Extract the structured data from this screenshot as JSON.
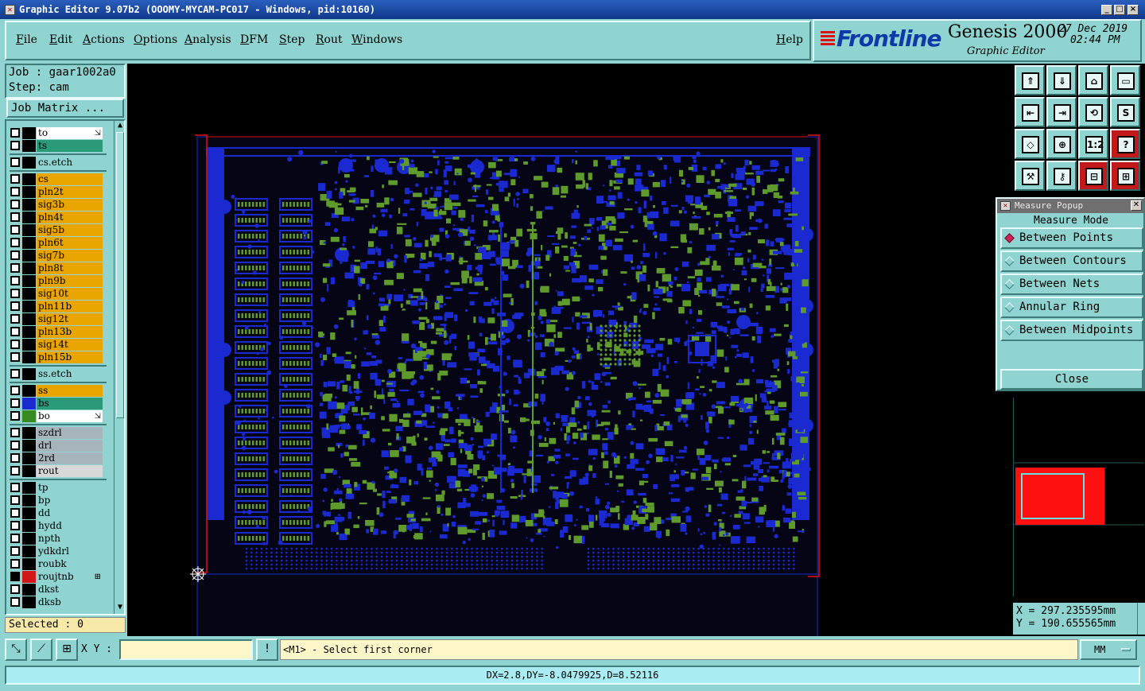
{
  "window": {
    "title": "Graphic Editor 9.07b2 (OOOMY-MYCAM-PC017 - Windows, pid:10160)",
    "icon": "app-icon",
    "minimize": "_",
    "maximize": "□",
    "close": "×"
  },
  "menu": {
    "items": [
      "File",
      "Edit",
      "Actions",
      "Options",
      "Analysis",
      "DFM",
      "Step",
      "Rout",
      "Windows"
    ],
    "help": "Help"
  },
  "brand": {
    "logo": "Frontline",
    "product": "Genesis 2000",
    "subtitle": "Graphic Editor",
    "date": "27 Dec 2019",
    "time": "02:44 PM"
  },
  "job": {
    "job_line": "Job : gaar1002a0",
    "step_line": "Step: cam",
    "matrix_button": "Job Matrix ..."
  },
  "layers": [
    {
      "name": "to",
      "bg": "#ffffff",
      "swatch": "#000000",
      "mark": "⇲"
    },
    {
      "name": "ts",
      "bg": "#2a9a78",
      "swatch": "#000000"
    },
    {
      "sep": true
    },
    {
      "name": "cs.etch",
      "bg": "#8fd4d0",
      "swatch": "#000000"
    },
    {
      "sep": true
    },
    {
      "name": "cs",
      "bg": "#e8a500",
      "swatch": "#000000"
    },
    {
      "name": "pln2t",
      "bg": "#e8a500",
      "swatch": "#000000"
    },
    {
      "name": "sig3b",
      "bg": "#e8a500",
      "swatch": "#000000"
    },
    {
      "name": "pln4t",
      "bg": "#e8a500",
      "swatch": "#000000"
    },
    {
      "name": "sig5b",
      "bg": "#e8a500",
      "swatch": "#000000"
    },
    {
      "name": "pln6t",
      "bg": "#e8a500",
      "swatch": "#000000"
    },
    {
      "name": "sig7b",
      "bg": "#e8a500",
      "swatch": "#000000"
    },
    {
      "name": "pln8t",
      "bg": "#e8a500",
      "swatch": "#000000"
    },
    {
      "name": "pln9b",
      "bg": "#e8a500",
      "swatch": "#000000"
    },
    {
      "name": "sig10t",
      "bg": "#e8a500",
      "swatch": "#000000"
    },
    {
      "name": "pln11b",
      "bg": "#e8a500",
      "swatch": "#000000"
    },
    {
      "name": "sig12t",
      "bg": "#e8a500",
      "swatch": "#000000"
    },
    {
      "name": "pln13b",
      "bg": "#e8a500",
      "swatch": "#000000"
    },
    {
      "name": "sig14t",
      "bg": "#e8a500",
      "swatch": "#000000"
    },
    {
      "name": "pln15b",
      "bg": "#e8a500",
      "swatch": "#000000"
    },
    {
      "sep": true
    },
    {
      "name": "ss.etch",
      "bg": "#8fd4d0",
      "swatch": "#000000"
    },
    {
      "sep": true
    },
    {
      "name": "ss",
      "bg": "#e8a500",
      "swatch": "#000000"
    },
    {
      "name": "bs",
      "bg": "#2a9a78",
      "swatch": "#1a2ad0"
    },
    {
      "name": "bo",
      "bg": "#ffffff",
      "swatch": "#3a8a22",
      "mark": "⇲"
    },
    {
      "sep": true
    },
    {
      "name": "szdrl",
      "bg": "#a8b4bc",
      "swatch": "#000000"
    },
    {
      "name": "drl",
      "bg": "#a8b4bc",
      "swatch": "#000000"
    },
    {
      "name": "2rd",
      "bg": "#a8b4bc",
      "swatch": "#000000"
    },
    {
      "name": "rout",
      "bg": "#d8d8d8",
      "swatch": "#000000"
    },
    {
      "sep": true
    },
    {
      "name": "tp",
      "bg": "#8fd4d0",
      "swatch": "#000000"
    },
    {
      "name": "bp",
      "bg": "#8fd4d0",
      "swatch": "#000000"
    },
    {
      "name": "dd",
      "bg": "#8fd4d0",
      "swatch": "#000000"
    },
    {
      "name": "hydd",
      "bg": "#8fd4d0",
      "swatch": "#000000"
    },
    {
      "name": "npth",
      "bg": "#8fd4d0",
      "swatch": "#000000"
    },
    {
      "name": "ydkdrl",
      "bg": "#8fd4d0",
      "swatch": "#000000"
    },
    {
      "name": "roubk",
      "bg": "#8fd4d0",
      "swatch": "#000000"
    },
    {
      "name": "roujtnb",
      "bg": "#8fd4d0",
      "swatch": "#d01818",
      "mark": "⊞",
      "checked": true
    },
    {
      "name": "dkst",
      "bg": "#8fd4d0",
      "swatch": "#000000"
    },
    {
      "name": "dksb",
      "bg": "#8fd4d0",
      "swatch": "#000000"
    }
  ],
  "selected": "Selected : 0",
  "measure_popup": {
    "title": "Measure Popup",
    "header": "Measure Mode",
    "options": [
      "Between Points",
      "Between Contours",
      "Between Nets",
      "Annular Ring",
      "Between Midpoints"
    ],
    "selected_index": 0,
    "close_label": "Close"
  },
  "coords": {
    "x": "X  =  297.235595mm",
    "y": "Y  =  190.655565mm"
  },
  "bottom": {
    "xy_label": "X Y :",
    "xy_value": "",
    "prompt": "<M1> - Select first corner",
    "units": "MM",
    "info_button": "!"
  },
  "status": "DX=2.8,DY=-8.0479925,D=8.52116",
  "colors": {
    "panel": "#8fd4d0",
    "board_blue": "#1a2ad0",
    "board_green": "#5f9b2c",
    "profile_red": "#e01010",
    "canvas_bg": "#000000"
  }
}
